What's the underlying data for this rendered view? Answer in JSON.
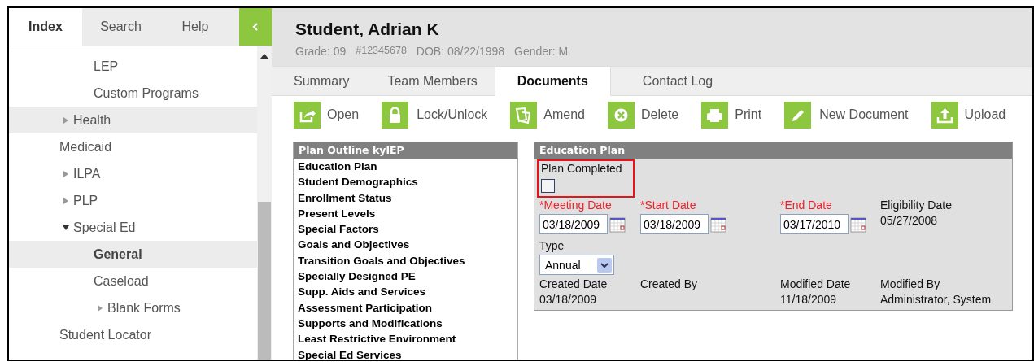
{
  "sidebar": {
    "tabs": [
      {
        "label": "Index",
        "selected": true
      },
      {
        "label": "Search",
        "selected": false
      },
      {
        "label": "Help",
        "selected": false
      }
    ],
    "tree": [
      {
        "children": [
          {
            "label": "LEP",
            "selected": false,
            "highlighted": false
          },
          {
            "label": "Custom Programs",
            "selected": false,
            "highlighted": false
          }
        ]
      },
      {
        "label": "Health",
        "expanded": false,
        "selected": false,
        "highlighted": true
      },
      {
        "label": "Medicaid",
        "selected": false,
        "highlighted": false
      },
      {
        "label": "ILPA",
        "expanded": false,
        "selected": false,
        "highlighted": false
      },
      {
        "label": "PLP",
        "expanded": false,
        "selected": false,
        "highlighted": false
      },
      {
        "label": "Special Ed",
        "expanded": true,
        "selected": false,
        "highlighted": false,
        "children": [
          {
            "label": "General",
            "selected": true,
            "highlighted": false
          },
          {
            "label": "Caseload",
            "selected": false,
            "highlighted": false
          },
          {
            "label": "Blank Forms",
            "expanded": false,
            "selected": false,
            "highlighted": false
          }
        ]
      },
      {
        "label": "Student Locator",
        "selected": false,
        "highlighted": false
      }
    ]
  },
  "student": {
    "name": "Student, Adrian K",
    "grade": "Grade: 09",
    "id": "#12345678",
    "dob": "DOB: 08/22/1998",
    "gender": "Gender: M"
  },
  "tabs": [
    {
      "label": "Summary",
      "selected": false
    },
    {
      "label": "Team Members",
      "selected": false
    },
    {
      "label": "Documents",
      "selected": true
    },
    {
      "label": "Contact Log",
      "selected": false
    }
  ],
  "toolbar": [
    {
      "label": "Open"
    },
    {
      "label": "Lock/Unlock"
    },
    {
      "label": "Amend"
    },
    {
      "label": "Delete"
    },
    {
      "label": "Print"
    },
    {
      "label": "New Document"
    },
    {
      "label": "Upload"
    }
  ],
  "outline": {
    "title": "Plan Outline kyIEP",
    "items": [
      "Education Plan",
      "Student Demographics",
      "Enrollment Status",
      "Present Levels",
      "Special Factors",
      "Goals and Objectives",
      "Transition Goals and Objectives",
      "Specially Designed PE",
      "Supp. Aids and Services",
      "Assessment Participation",
      "Supports and Modifications",
      "Least Restrictive Environment",
      "Special Ed Services"
    ]
  },
  "form": {
    "title": "Education Plan",
    "plan_completed": {
      "label": "Plan Completed",
      "checked": false,
      "highlighted": true
    },
    "dates": [
      {
        "label": "*Meeting Date",
        "required": true,
        "value": "03/18/2009"
      },
      {
        "label": "*Start Date",
        "required": true,
        "value": "03/18/2009"
      },
      {
        "label": "*End Date",
        "required": true,
        "value": "03/17/2010"
      }
    ],
    "eligibility": {
      "label": "Eligibility Date",
      "value": "05/27/2008"
    },
    "type": {
      "label": "Type",
      "value": "Annual"
    },
    "info": [
      {
        "label": "Created Date",
        "value": "03/18/2009"
      },
      {
        "label": "Created By"
      },
      {
        "label": "Modified Date",
        "value": "11/18/2009"
      },
      {
        "label": "Modified By",
        "value": "Administrator, System"
      }
    ]
  }
}
